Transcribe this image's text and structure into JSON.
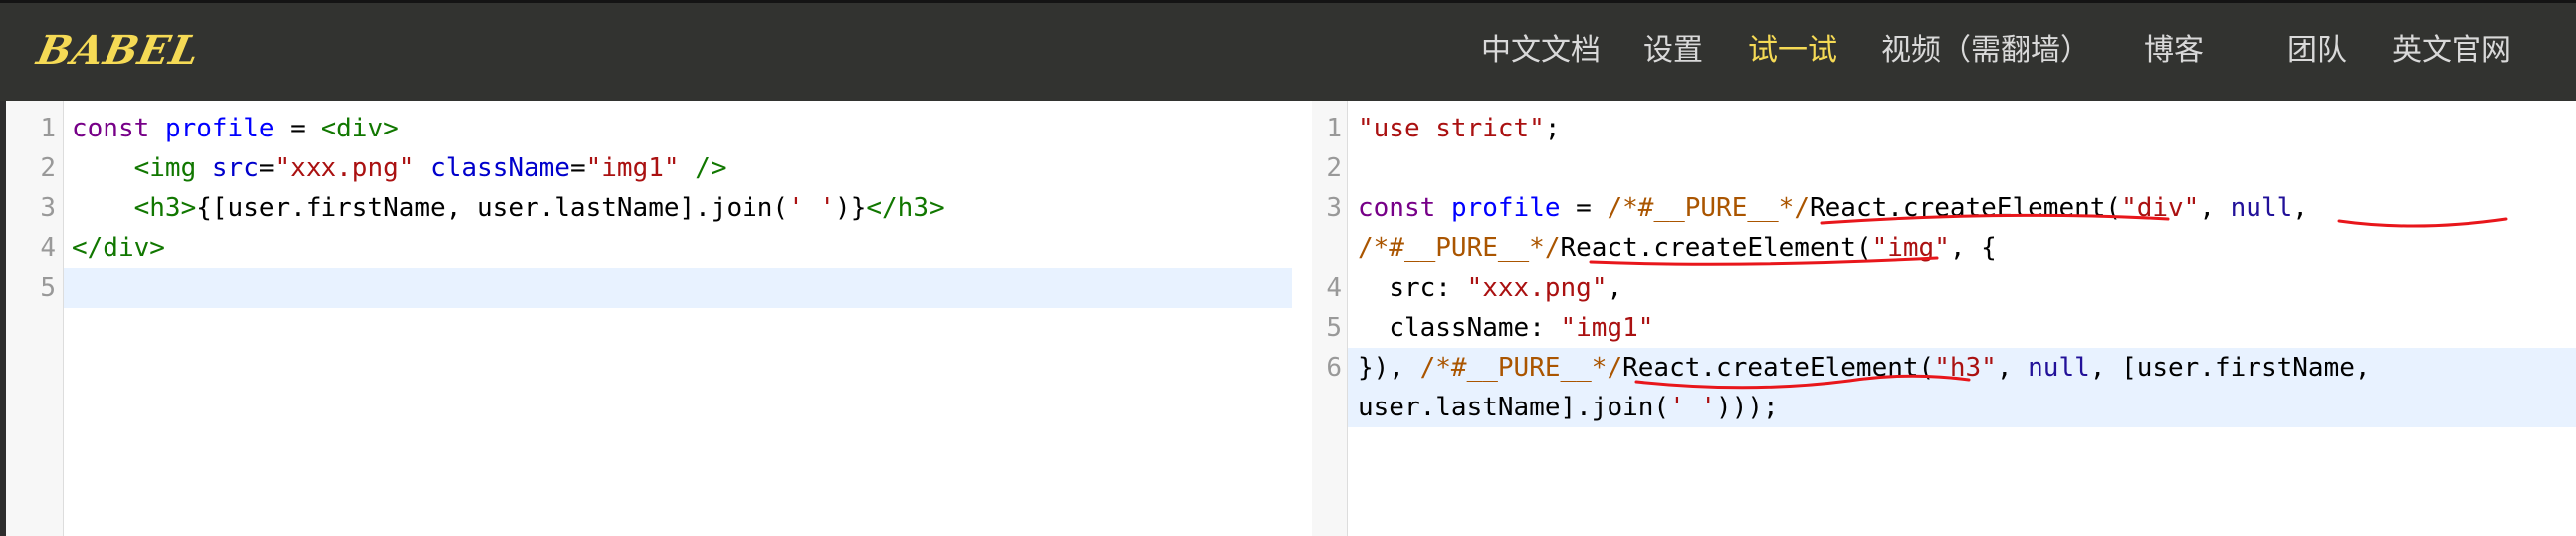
{
  "header": {
    "logo": "BABEL",
    "nav": [
      {
        "label": "中文文档",
        "active": false
      },
      {
        "label": "设置",
        "active": false
      },
      {
        "label": "试一试",
        "active": true
      },
      {
        "label": "视频（需翻墙）",
        "active": false
      },
      {
        "label": "博客",
        "active": false
      },
      {
        "label": "团队",
        "active": false
      },
      {
        "label": "英文官网",
        "active": false
      }
    ]
  },
  "colors": {
    "header_bg": "#323330",
    "logo": "#f5da55",
    "nav_text": "#d9d9d9",
    "nav_active": "#f5da55",
    "active_line": "#e8f2ff",
    "annotation_underline": "#e8161b"
  },
  "input_editor": {
    "line_numbers": [
      "1",
      "2",
      "3",
      "4",
      "5"
    ],
    "lines": {
      "l1": {
        "kw": "const",
        "sp1": " ",
        "def": "profile",
        "eq": " = ",
        "tag": "<div>"
      },
      "l2": {
        "indent": "    ",
        "tag_open": "<img",
        "sp1": " ",
        "attr1": "src",
        "eq1": "=",
        "val1": "\"xxx.png\"",
        "sp2": " ",
        "attr2": "className",
        "eq2": "=",
        "val2": "\"img1\"",
        "tag_close": " />"
      },
      "l3": {
        "indent": "    ",
        "tag_open": "<h3>",
        "expr1": "{[user.firstName, user.lastName].join(",
        "str": "' '",
        "expr2": ")}",
        "tag_close": "</h3>"
      },
      "l4": {
        "tag": "</div>"
      },
      "l5": {
        "text": ""
      }
    }
  },
  "output_editor": {
    "line_numbers": [
      "1",
      "2",
      "3",
      "4",
      "5",
      "6"
    ],
    "lines": {
      "l1": {
        "str": "\"use strict\"",
        "semi": ";"
      },
      "l2": {
        "text": ""
      },
      "l3a": {
        "kw": "const",
        "sp1": " ",
        "def": "profile",
        "eq": " = ",
        "cmt": "/*#__PURE__*/",
        "call": "React.createElement(",
        "str1": "\"div\"",
        "comma1": ", ",
        "atom": "null",
        "comma2": ","
      },
      "l3b": {
        "cmt": "/*#__PURE__*/",
        "call": "React.createElement(",
        "str1": "\"img\"",
        "rest": ", {"
      },
      "l4": {
        "indent": "  ",
        "prop": "src: ",
        "str": "\"xxx.png\"",
        "comma": ","
      },
      "l5": {
        "indent": "  ",
        "prop": "className: ",
        "str": "\"img1\""
      },
      "l6a": {
        "start": "}), ",
        "cmt": "/*#__PURE__*/",
        "call": "React.createElement(",
        "str1": "\"h3\"",
        "comma1": ", ",
        "atom": "null",
        "rest": ", [user.firstName,"
      },
      "l6b": {
        "expr1": "user.lastName].join(",
        "str": "' '",
        "expr2": ")));"
      }
    }
  }
}
